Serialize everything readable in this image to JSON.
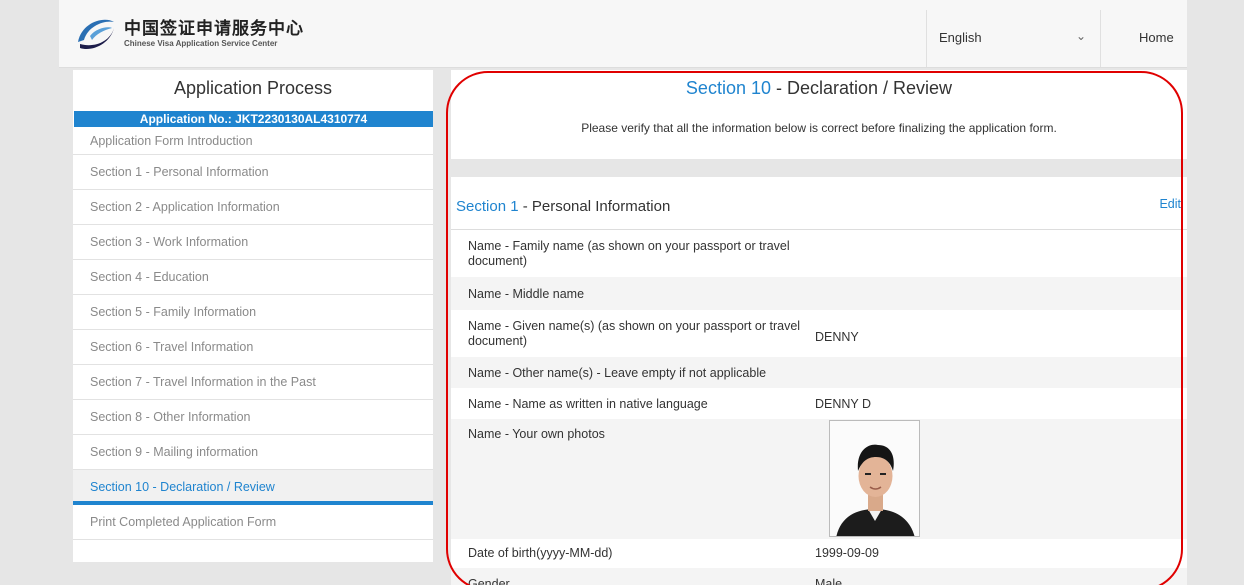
{
  "header": {
    "logo_cn": "中国签证申请服务中心",
    "logo_en": "Chinese Visa Application Service Center",
    "language": "English",
    "home": "Home"
  },
  "sidebar": {
    "title": "Application Process",
    "application_no": "Application No.: JKT2230130AL4310774",
    "items": [
      {
        "label": "Application Form Introduction"
      },
      {
        "label": "Section 1 - Personal Information"
      },
      {
        "label": "Section 2 - Application Information"
      },
      {
        "label": "Section 3 - Work Information"
      },
      {
        "label": "Section 4 - Education"
      },
      {
        "label": "Section 5 - Family Information"
      },
      {
        "label": "Section 6 - Travel Information"
      },
      {
        "label": "Section 7 - Travel Information in the Past"
      },
      {
        "label": "Section 8 - Other Information"
      },
      {
        "label": "Section 9 - Mailing information"
      },
      {
        "label": "Section 10 - Declaration / Review"
      },
      {
        "label": "Print Completed Application Form"
      }
    ],
    "active_index": 10
  },
  "main": {
    "title_section": "Section 10",
    "title_rest": " - Declaration / Review",
    "verify_text": "Please verify that all the information below is correct before finalizing the application form.",
    "section": {
      "number": "Section 1",
      "name": " - Personal Information",
      "edit": "Edit"
    },
    "rows": [
      {
        "label": "Name - Family name (as shown on your passport or travel document)",
        "value": ""
      },
      {
        "label": "Name - Middle name",
        "value": ""
      },
      {
        "label": "Name - Given name(s) (as shown on your passport or travel document)",
        "value": "DENNY"
      },
      {
        "label": "Name - Other name(s) - Leave empty if not applicable",
        "value": ""
      },
      {
        "label": "Name - Name as written in native language",
        "value": "DENNY D"
      },
      {
        "label": "Name - Your own photos",
        "value": ""
      },
      {
        "label": "Date of birth(yyyy-MM-dd)",
        "value": "1999-09-09"
      },
      {
        "label": "Gender",
        "value": "Male"
      }
    ]
  },
  "colors": {
    "accent": "#1f84cf",
    "annotation": "#e00000"
  }
}
